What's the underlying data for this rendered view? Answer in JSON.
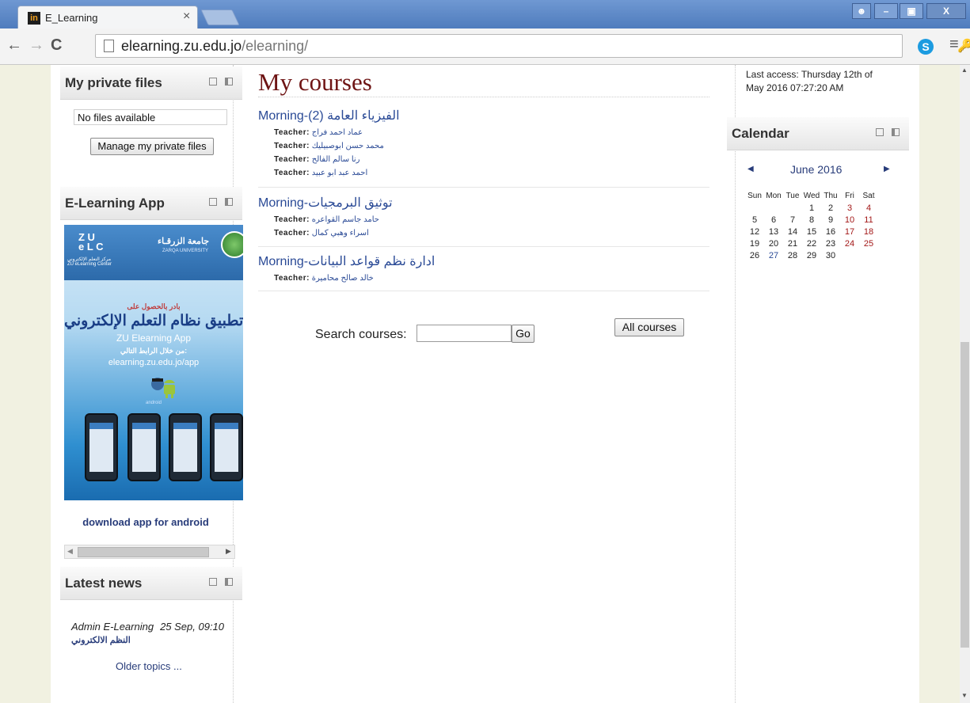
{
  "browser": {
    "tab_title": "E_Learning",
    "tab_favicon": "in",
    "url_host": "elearning.zu.edu.jo",
    "url_path": "/elearning/"
  },
  "blocks": {
    "private_files": {
      "title": "My private files",
      "empty_text": "No files available",
      "manage_button": "Manage my private files"
    },
    "app": {
      "title": "E-Learning App",
      "banner": {
        "university_ar": "جامعة الزرقـاء",
        "university_en": "ZARQA UNIVERSITY",
        "center_ar": "مركز التعلم الإلكتروني",
        "center_en": "ZU eLearning Center",
        "cta_small": "بادر بالحصول على",
        "cta_big": "تطبيق نظام التعلم الإلكتروني",
        "app_name": "ZU Elearning App",
        "via_link": "من خلال الرابط التالي:",
        "link": "elearning.zu.edu.jo/app",
        "android_word": "android"
      },
      "download_link": "download app for android"
    },
    "latest_news": {
      "title": "Latest news",
      "author": "Admin E-Learning",
      "date": "25 Sep, 09:10",
      "headline": "النظم الالكتروني",
      "older": "Older topics ..."
    }
  },
  "main": {
    "title": "My courses",
    "courses": [
      {
        "name": "Morning-(الفيزياء العامة (2",
        "teachers": [
          "عماد احمد فراج",
          "محمد حسن ابوصبيليك",
          "رنا سالم الفالح",
          "احمد عبد ابو عبيد"
        ]
      },
      {
        "name": "Morning-توثيق البرمجيات",
        "teachers": [
          "حامد جاسم القواعره",
          "اسراء وهبي كمال"
        ]
      },
      {
        "name": "Morning-ادارة نظم قواعد البيانات",
        "teachers": [
          "خالد صالح محاميرة"
        ]
      }
    ],
    "teacher_label": "Teacher:",
    "search_label": "Search courses:",
    "search_value": "",
    "go_button": "Go",
    "all_courses_button": "All courses"
  },
  "right": {
    "last_access": "Last access: Thursday 12th of May 2016 07:27:20 AM",
    "calendar": {
      "title": "Calendar",
      "month": "June 2016",
      "weekdays": [
        "Sun",
        "Mon",
        "Tue",
        "Wed",
        "Thu",
        "Fri",
        "Sat"
      ],
      "weeks": [
        [
          "",
          "",
          "",
          "1",
          "2",
          "3",
          "4"
        ],
        [
          "5",
          "6",
          "7",
          "8",
          "9",
          "10",
          "11"
        ],
        [
          "12",
          "13",
          "14",
          "15",
          "16",
          "17",
          "18"
        ],
        [
          "19",
          "20",
          "21",
          "22",
          "23",
          "24",
          "25"
        ],
        [
          "26",
          "27",
          "28",
          "29",
          "30",
          "",
          ""
        ]
      ],
      "highlight_day": "27",
      "weekend_color": "#a31818",
      "link_color": "#2a4a96"
    }
  },
  "colors": {
    "accent_title": "#6e1414",
    "link": "#2a4a96",
    "page_margin_bg": "#f1f1e1",
    "titlebar": "#5a86c4"
  }
}
